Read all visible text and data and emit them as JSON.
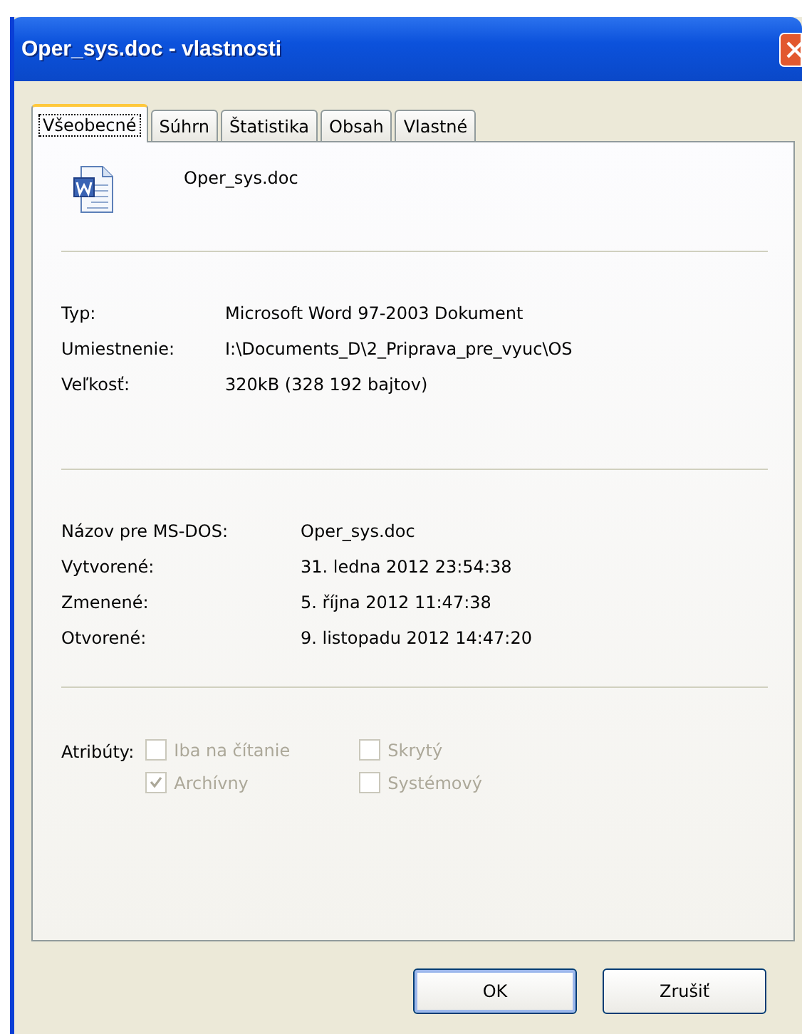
{
  "window": {
    "title": "Oper_sys.doc - vlastnosti"
  },
  "tabs": [
    {
      "label": "Všeobecné",
      "selected": true
    },
    {
      "label": "Súhrn",
      "selected": false
    },
    {
      "label": "Štatistika",
      "selected": false
    },
    {
      "label": "Obsah",
      "selected": false
    },
    {
      "label": "Vlastné",
      "selected": false
    }
  ],
  "file": {
    "name": "Oper_sys.doc"
  },
  "info": [
    {
      "label": "Typ:",
      "value": "Microsoft Word 97-2003 Dokument"
    },
    {
      "label": "Umiestnenie:",
      "value": "I:\\Documents_D\\2_Priprava_pre_vyuc\\OS"
    },
    {
      "label": "Veľkosť:",
      "value": "320kB (328 192 bajtov)"
    }
  ],
  "dates": [
    {
      "label": "Názov pre MS-DOS:",
      "value": "Oper_sys.doc"
    },
    {
      "label": "Vytvorené:",
      "value": "31. ledna 2012 23:54:38"
    },
    {
      "label": "Zmenené:",
      "value": "5. října 2012 11:47:38"
    },
    {
      "label": "Otvorené:",
      "value": "9. listopadu 2012 14:47:20"
    }
  ],
  "attributes": {
    "label": "Atribúty:",
    "items": [
      {
        "label": "Iba na čítanie",
        "checked": false,
        "disabled": true
      },
      {
        "label": "Skrytý",
        "checked": false,
        "disabled": true
      },
      {
        "label": "Archívny",
        "checked": true,
        "disabled": true
      },
      {
        "label": "Systémový",
        "checked": false,
        "disabled": true
      }
    ]
  },
  "buttons": [
    "OK",
    "Zrušiť"
  ]
}
